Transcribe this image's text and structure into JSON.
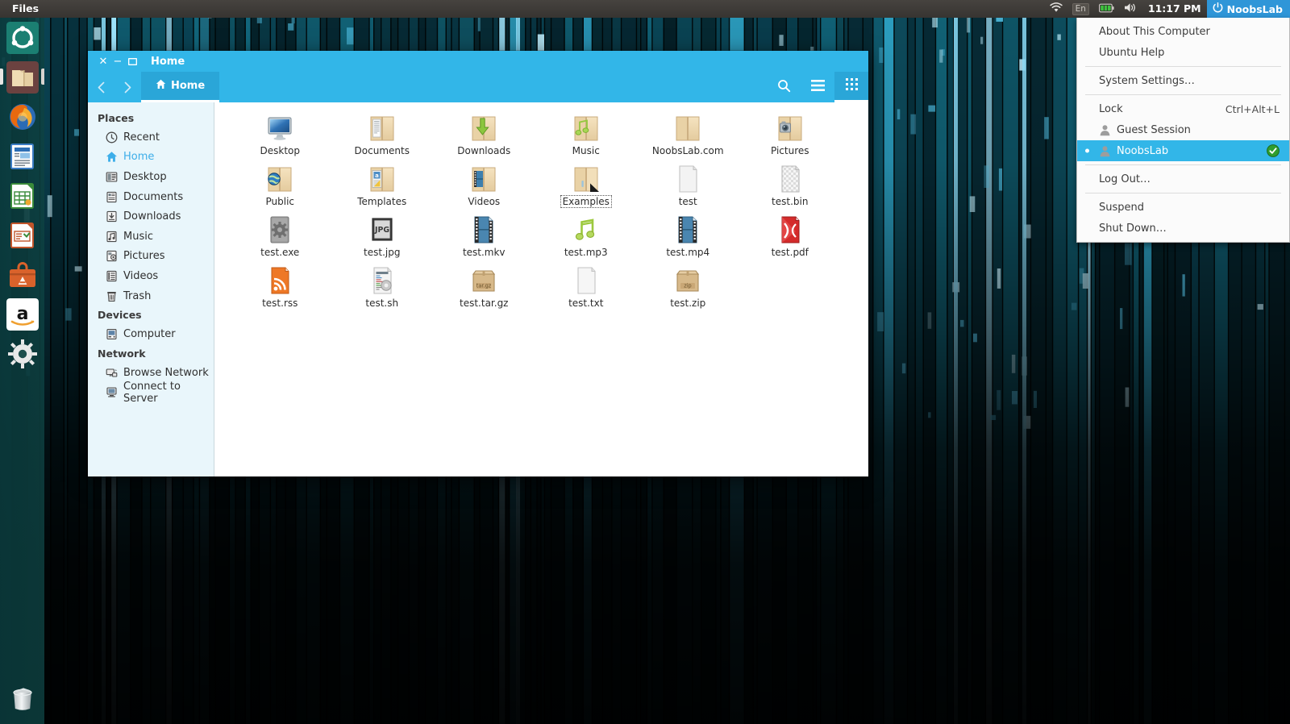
{
  "panel": {
    "app_name": "Files",
    "clock": "11:17 PM",
    "session_user": "NoobsLab",
    "keyboard_layout": "En",
    "indicators": [
      "wifi-icon",
      "keyboard-layout-indicator",
      "battery-icon",
      "volume-icon"
    ],
    "accent": "#2f96d8"
  },
  "session_menu": {
    "items": [
      {
        "label": "About This Computer",
        "accel": "",
        "icon": "",
        "highlighted": false,
        "sep_after": false
      },
      {
        "label": "Ubuntu Help",
        "accel": "",
        "icon": "",
        "highlighted": false,
        "sep_after": true
      },
      {
        "label": "System Settings…",
        "accel": "",
        "icon": "",
        "highlighted": false,
        "sep_after": true
      },
      {
        "label": "Lock",
        "accel": "Ctrl+Alt+L",
        "icon": "",
        "highlighted": false,
        "sep_after": false
      },
      {
        "label": "Guest Session",
        "accel": "",
        "icon": "user-icon",
        "highlighted": false,
        "sep_after": false
      },
      {
        "label": "NoobsLab",
        "accel": "",
        "icon": "user-icon",
        "highlighted": true,
        "checked": true,
        "sep_after": true
      },
      {
        "label": "Log Out…",
        "accel": "",
        "icon": "",
        "highlighted": false,
        "sep_after": true
      },
      {
        "label": "Suspend",
        "accel": "",
        "icon": "",
        "highlighted": false,
        "sep_after": false
      },
      {
        "label": "Shut Down…",
        "accel": "",
        "icon": "",
        "highlighted": false,
        "sep_after": false
      }
    ],
    "highlight_color": "#32b6e8"
  },
  "launcher": {
    "items": [
      {
        "name": "ubuntu-dash",
        "label": "Dash Home",
        "active": false
      },
      {
        "name": "files",
        "label": "Files",
        "active": true
      },
      {
        "name": "firefox",
        "label": "Firefox Web Browser",
        "active": false
      },
      {
        "name": "libreoffice-writer",
        "label": "LibreOffice Writer",
        "active": false
      },
      {
        "name": "libreoffice-calc",
        "label": "LibreOffice Calc",
        "active": false
      },
      {
        "name": "libreoffice-impress",
        "label": "LibreOffice Impress",
        "active": false
      },
      {
        "name": "ubuntu-software",
        "label": "Ubuntu Software",
        "active": false
      },
      {
        "name": "amazon",
        "label": "Amazon",
        "active": false
      },
      {
        "name": "system-settings",
        "label": "System Settings",
        "active": false
      }
    ],
    "trash": {
      "name": "trash",
      "label": "Trash"
    }
  },
  "file_manager": {
    "window_title": "Home",
    "breadcrumb": "Home",
    "back_label": "Back",
    "forward_label": "Forward",
    "toolbar_icons": [
      "search-icon",
      "hamburger-menu-icon",
      "grid-view-icon"
    ],
    "sidebar": {
      "groups": [
        {
          "heading": "Places",
          "items": [
            {
              "label": "Recent",
              "icon": "clock-icon",
              "selected": false
            },
            {
              "label": "Home",
              "icon": "home-icon",
              "selected": true
            },
            {
              "label": "Desktop",
              "icon": "desktop-icon",
              "selected": false
            },
            {
              "label": "Documents",
              "icon": "documents-icon",
              "selected": false
            },
            {
              "label": "Downloads",
              "icon": "downloads-icon",
              "selected": false
            },
            {
              "label": "Music",
              "icon": "music-icon",
              "selected": false
            },
            {
              "label": "Pictures",
              "icon": "pictures-icon",
              "selected": false
            },
            {
              "label": "Videos",
              "icon": "videos-icon",
              "selected": false
            },
            {
              "label": "Trash",
              "icon": "trash-icon",
              "selected": false
            }
          ]
        },
        {
          "heading": "Devices",
          "items": [
            {
              "label": "Computer",
              "icon": "computer-icon",
              "selected": false
            }
          ]
        },
        {
          "heading": "Network",
          "items": [
            {
              "label": "Browse Network",
              "icon": "network-icon",
              "selected": false
            },
            {
              "label": "Connect to Server",
              "icon": "server-icon",
              "selected": false
            }
          ]
        }
      ]
    },
    "files": [
      {
        "label": "Desktop",
        "icon": "folder-desktop",
        "selected": false
      },
      {
        "label": "Documents",
        "icon": "folder-documents",
        "selected": false
      },
      {
        "label": "Downloads",
        "icon": "folder-downloads",
        "selected": false
      },
      {
        "label": "Music",
        "icon": "folder-music",
        "selected": false
      },
      {
        "label": "NoobsLab.com",
        "icon": "folder-plain",
        "selected": false
      },
      {
        "label": "Pictures",
        "icon": "folder-pictures",
        "selected": false
      },
      {
        "label": "Public",
        "icon": "folder-public",
        "selected": false
      },
      {
        "label": "Templates",
        "icon": "folder-templates",
        "selected": false
      },
      {
        "label": "Videos",
        "icon": "folder-videos",
        "selected": false
      },
      {
        "label": "Examples",
        "icon": "folder-symlink",
        "selected": true
      },
      {
        "label": "test",
        "icon": "file-blank",
        "selected": false
      },
      {
        "label": "test.bin",
        "icon": "file-binary",
        "selected": false
      },
      {
        "label": "test.exe",
        "icon": "file-exe",
        "selected": false
      },
      {
        "label": "test.jpg",
        "icon": "file-jpg",
        "selected": false
      },
      {
        "label": "test.mkv",
        "icon": "file-video",
        "selected": false
      },
      {
        "label": "test.mp3",
        "icon": "file-audio",
        "selected": false
      },
      {
        "label": "test.mp4",
        "icon": "file-video",
        "selected": false
      },
      {
        "label": "test.pdf",
        "icon": "file-pdf",
        "selected": false
      },
      {
        "label": "test.rss",
        "icon": "file-rss",
        "selected": false
      },
      {
        "label": "test.sh",
        "icon": "file-script",
        "selected": false
      },
      {
        "label": "test.tar.gz",
        "icon": "file-targz",
        "selected": false
      },
      {
        "label": "test.txt",
        "icon": "file-text",
        "selected": false
      },
      {
        "label": "test.zip",
        "icon": "file-zip",
        "selected": false
      }
    ],
    "titlebar_buttons": [
      "close",
      "minimize",
      "maximize"
    ],
    "accent": "#32b6e8"
  }
}
